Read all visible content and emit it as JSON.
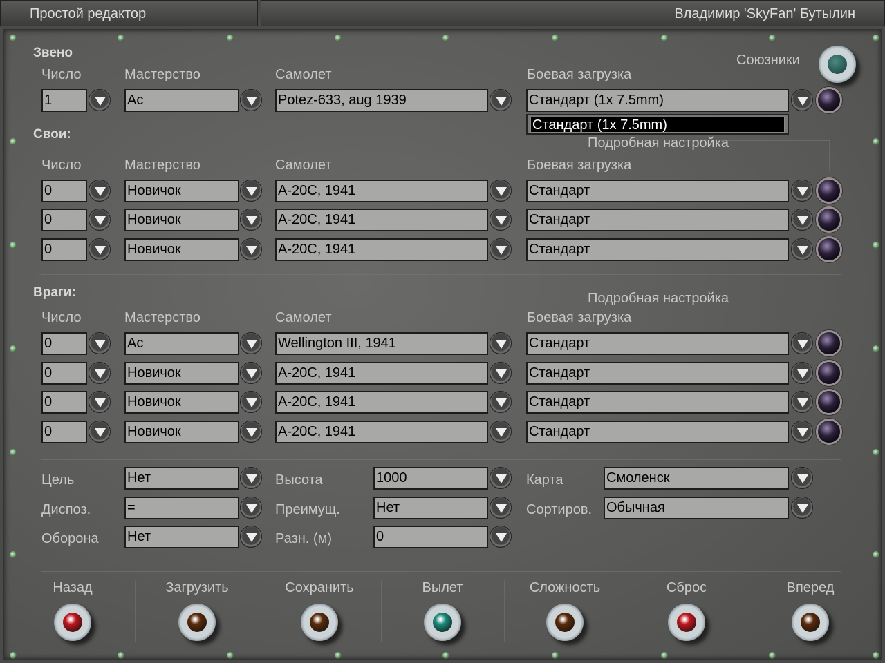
{
  "titlebar": {
    "title": "Простой редактор",
    "user": "Владимир 'SkyFan' Бутылин"
  },
  "columns": {
    "count": "Число",
    "skill": "Мастерство",
    "plane": "Самолет",
    "loadout": "Боевая загрузка"
  },
  "allies_label": "Союзники",
  "detail_label": "Подробная настройка",
  "flight": {
    "label": "Звено",
    "rows": [
      {
        "count": "1",
        "skill": "Ас",
        "plane": "Potez-633, aug 1939",
        "loadout": "Стандарт (1x 7.5mm)"
      }
    ]
  },
  "loadout_dropdown": {
    "options": [
      "Стандарт (1x 7.5mm)"
    ]
  },
  "friendly": {
    "label": "Свои:",
    "rows": [
      {
        "count": "0",
        "skill": "Новичок",
        "plane": "A-20C, 1941",
        "loadout": "Стандарт"
      },
      {
        "count": "0",
        "skill": "Новичок",
        "plane": "A-20C, 1941",
        "loadout": "Стандарт"
      },
      {
        "count": "0",
        "skill": "Новичок",
        "plane": "A-20C, 1941",
        "loadout": "Стандарт"
      }
    ]
  },
  "enemy": {
    "label": "Враги:",
    "rows": [
      {
        "count": "0",
        "skill": "Ас",
        "plane": "Wellington III, 1941",
        "loadout": "Стандарт"
      },
      {
        "count": "0",
        "skill": "Новичок",
        "plane": "A-20C, 1941",
        "loadout": "Стандарт"
      },
      {
        "count": "0",
        "skill": "Новичок",
        "plane": "A-20C, 1941",
        "loadout": "Стандарт"
      },
      {
        "count": "0",
        "skill": "Новичок",
        "plane": "A-20C, 1941",
        "loadout": "Стандарт"
      }
    ]
  },
  "params": [
    {
      "label": "Цель",
      "value": "Нет"
    },
    {
      "label": "Диспоз.",
      "value": "="
    },
    {
      "label": "Оборона",
      "value": "Нет"
    },
    {
      "label": "Высота",
      "value": "1000"
    },
    {
      "label": "Преимущ.",
      "value": "Нет"
    },
    {
      "label": "Разн. (м)",
      "value": "0"
    },
    {
      "label": "Карта",
      "value": "Смоленск"
    },
    {
      "label": "Сортиров.",
      "value": "Обычная"
    }
  ],
  "buttons": [
    {
      "label": "Назад",
      "color": "#c0161e"
    },
    {
      "label": "Загрузить",
      "color": "#5a2a0a"
    },
    {
      "label": "Сохранить",
      "color": "#5a2a0a"
    },
    {
      "label": "Вылет",
      "color": "#1a8a7a"
    },
    {
      "label": "Сложность",
      "color": "#5a2a0a"
    },
    {
      "label": "Сброс",
      "color": "#c0161e"
    },
    {
      "label": "Вперед",
      "color": "#5a2a0a"
    }
  ]
}
